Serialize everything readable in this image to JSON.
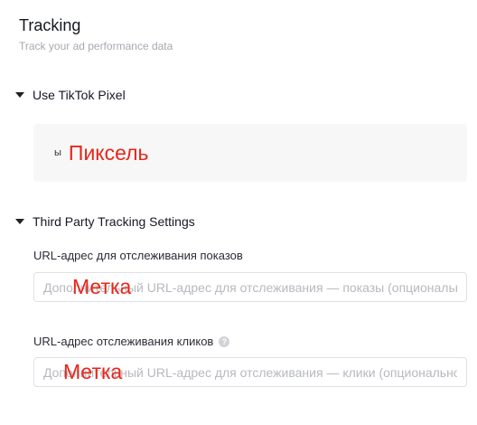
{
  "header": {
    "title": "Tracking",
    "subtitle": "Track your ad performance data"
  },
  "pixel_section": {
    "title": "Use TikTok Pixel",
    "small_text": "ы",
    "label": "Пиксель"
  },
  "third_party_section": {
    "title": "Third Party Tracking Settings",
    "impression": {
      "label": "URL-адрес для отслеживания показов",
      "placeholder": "Дополнительный URL-адрес для отслеживания — показы (опционально)",
      "overlay": "Метка"
    },
    "click": {
      "label": "URL-адрес отслеживания кликов",
      "help_icon": "question-circle-icon",
      "help_glyph": "?",
      "placeholder": "Дополнительный URL-адрес для отслеживания — клики (опционально)",
      "overlay": "Метка"
    }
  },
  "colors": {
    "overlay_red": "#e8261a",
    "box_background": "#f7f7f8",
    "input_border": "#e0e1e5"
  }
}
